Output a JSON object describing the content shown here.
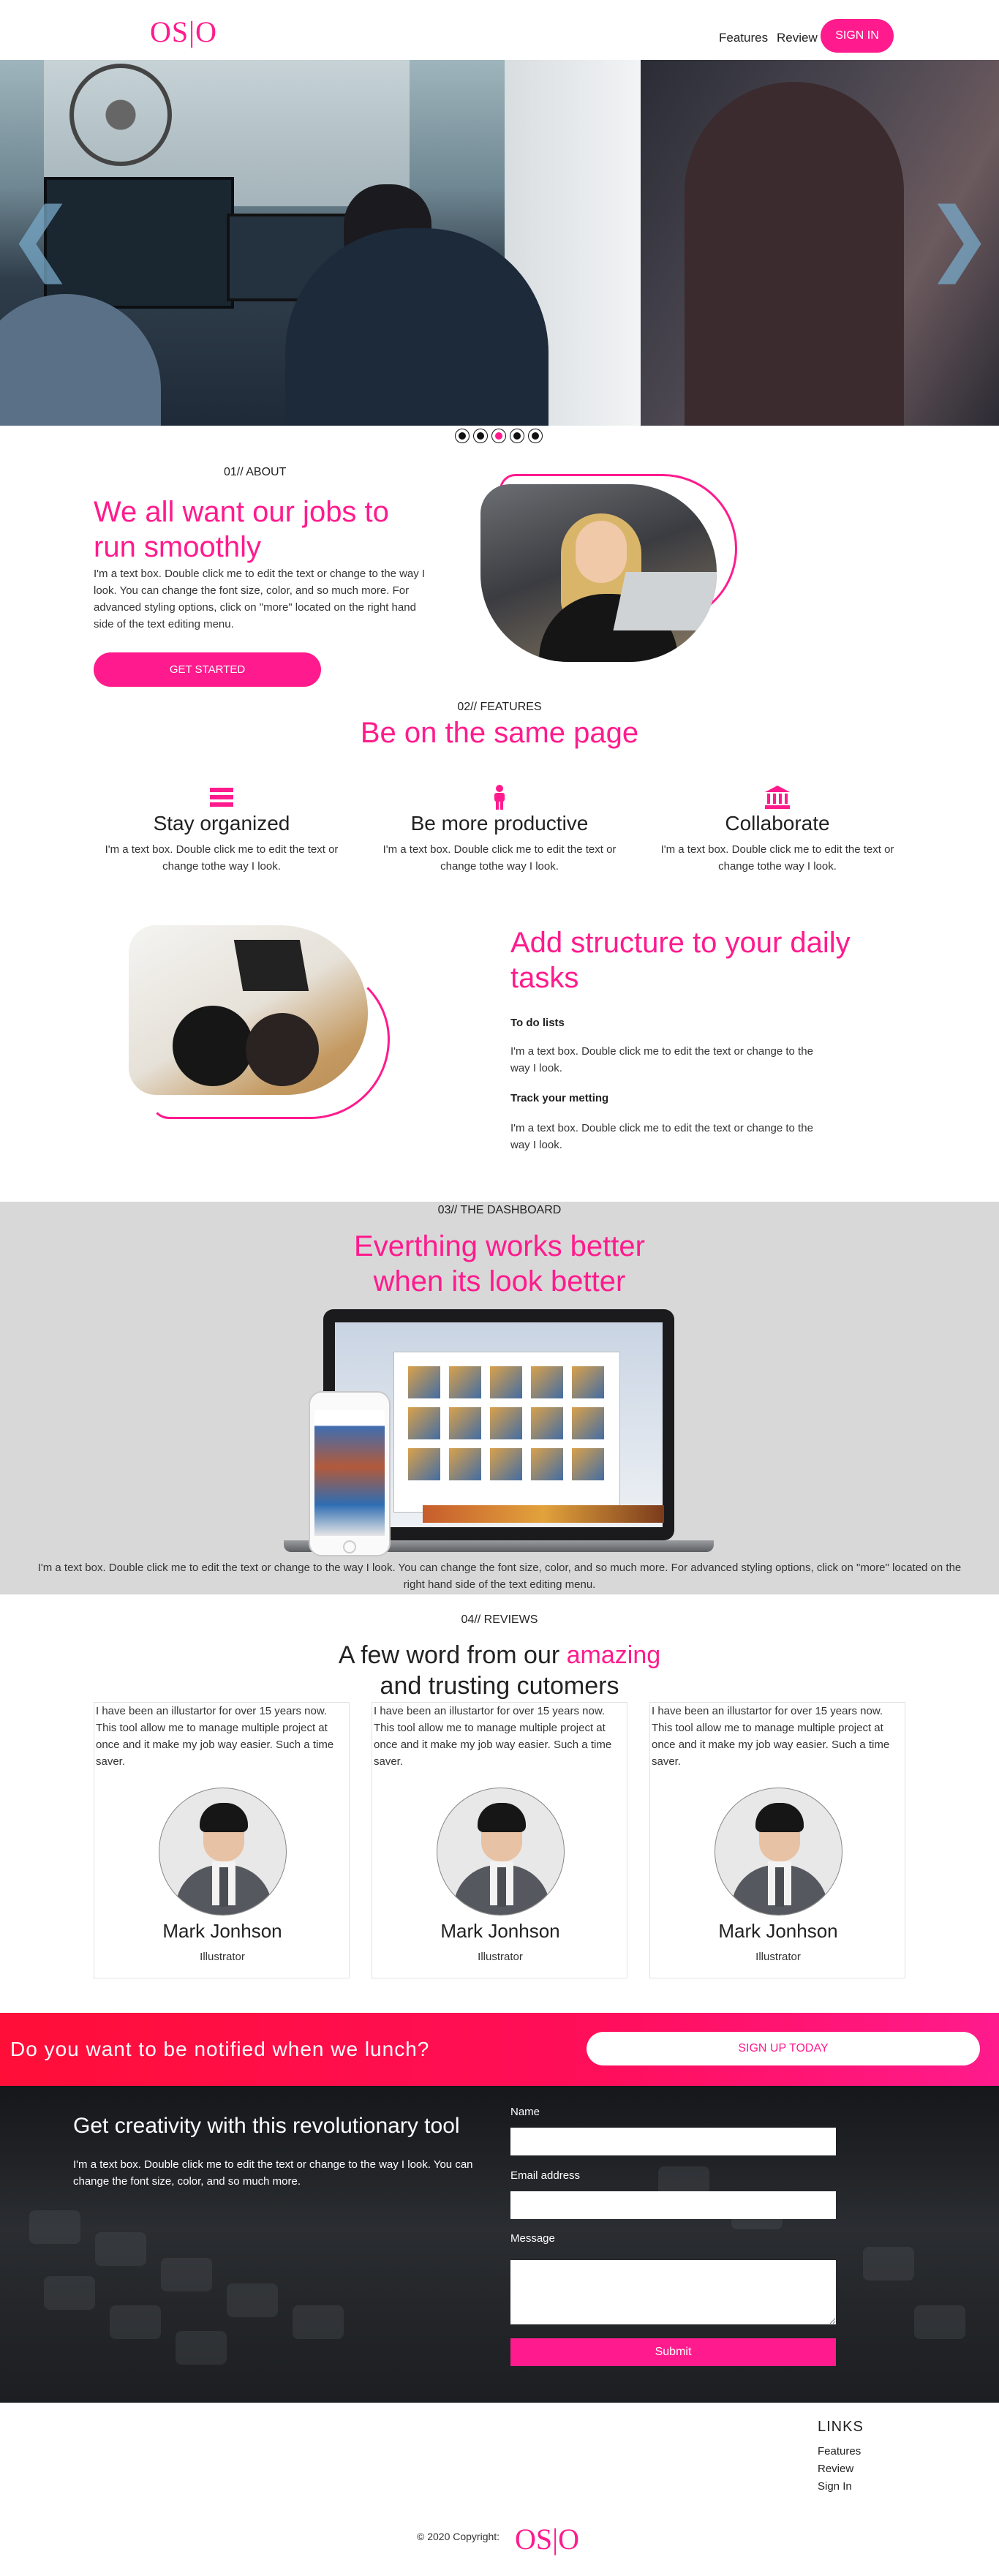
{
  "header": {
    "logo": "OS|O",
    "nav": [
      "Features",
      "Review"
    ],
    "signin_label": "SIGN IN"
  },
  "hero": {
    "prev_arrow": "❮",
    "next_arrow": "❯",
    "slide_count": 5,
    "active_slide": 3
  },
  "about": {
    "label": "01// ABOUT",
    "title": "We all want our jobs to run smoothly",
    "text": "I'm a text box. Double click me to edit the text or change to the way I look. You can change the font size, color, and so much more. For advanced styling options, click on \"more\" located on the right hand side of the text editing menu.",
    "button": "GET STARTED"
  },
  "features": {
    "label": "02// FEATURES",
    "title": "Be on the same page",
    "items": [
      {
        "icon": "list-icon",
        "title": "Stay organized",
        "text": "I'm a text box. Double click me to edit the text or change tothe way I look."
      },
      {
        "icon": "person-icon",
        "title": "Be more productive",
        "text": "I'm a text box. Double click me to edit the text or change tothe way I look."
      },
      {
        "icon": "bank-icon",
        "title": "Collaborate",
        "text": "I'm a text box. Double click me to edit the text or change tothe way I look."
      }
    ]
  },
  "structure": {
    "title": "Add structure to your daily tasks",
    "sub1": "To do lists",
    "text1": "I'm a text box. Double click me to edit the text or change to the way I look.",
    "sub2": "Track your metting",
    "text2": "I'm a text box. Double click me to edit the text or change to the way I look."
  },
  "dashboard": {
    "label": "03// THE DASHBOARD",
    "title": "Everthing works better when its look better",
    "text": "I'm a text box. Double click me to edit the text or change to the way I look. You can change the font size, color, and so much more. For advanced styling options, click on \"more\" located on the right hand side of the text editing menu."
  },
  "reviews": {
    "label": "04// REVIEWS",
    "title_a": "A few word from our ",
    "title_highlight": "amazing",
    "title_b": "and trusting cutomers",
    "cards": [
      {
        "text": "I have been an illustartor for over 15 years now. This tool allow me to manage multiple project at once and it make my job way easier. Such a time saver.",
        "name": "Mark Jonhson",
        "role": "Illustrator"
      },
      {
        "text": "I have been an illustartor for over 15 years now. This tool allow me to manage multiple project at once and it make my job way easier. Such a time saver.",
        "name": "Mark Jonhson",
        "role": "Illustrator"
      },
      {
        "text": "I have been an illustartor for over 15 years now. This tool allow me to manage multiple project at once and it make my job way easier. Such a time saver.",
        "name": "Mark Jonhson",
        "role": "Illustrator"
      }
    ]
  },
  "notify": {
    "text": "Do you want to be notified when we lunch?",
    "button": "SIGN UP TODAY"
  },
  "contact": {
    "title": "Get creativity with this revolutionary tool",
    "text": "I'm a text box. Double click me to edit the text or change to the way I look. You can change the font size, color, and so much more.",
    "name_label": "Name",
    "email_label": "Email address",
    "message_label": "Message",
    "submit": "Submit"
  },
  "footer": {
    "links_title": "LINKS",
    "links": [
      "Features",
      "Review",
      "Sign In"
    ],
    "copyright": "© 2020 Copyright:",
    "logo": "OS|O"
  },
  "colors": {
    "accent": "#ff1b8d",
    "notify_start": "#ff0e38",
    "dashboard_bg": "#d8d8d8"
  }
}
